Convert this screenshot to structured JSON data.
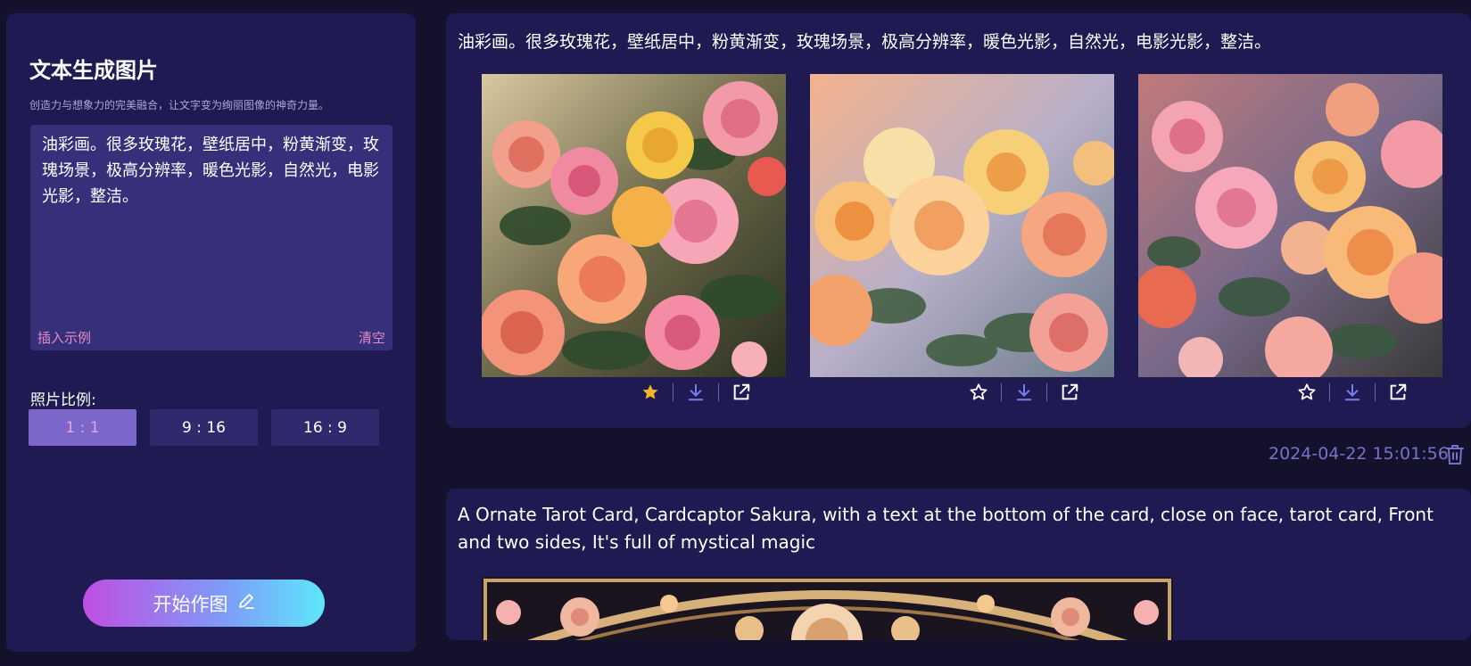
{
  "panel": {
    "title": "文本生成图片",
    "subtitle": "创造力与想象力的完美融合，让文字变为绚丽图像的神奇力量。",
    "prompt_value": "油彩画。很多玫瑰花，壁纸居中，粉黄渐变，玫瑰场景，极高分辨率，暖色光影，自然光，电影光影，整洁。",
    "insert_example_label": "插入示例",
    "clear_label": "清空",
    "ratio_label": "照片比例:",
    "ratios": [
      "1 : 1",
      "9 : 16",
      "16 : 9"
    ],
    "selected_ratio": "1 : 1",
    "start_label": "开始作图"
  },
  "results": [
    {
      "prompt": "油彩画。很多玫瑰花，壁纸居中，粉黄渐变，玫瑰场景，极高分辨率，暖色光影，自然光，电影光影，整洁。",
      "images": [
        {
          "favorited": true
        },
        {
          "favorited": false
        },
        {
          "favorited": false
        }
      ],
      "timestamp": "2024-04-22 15:01:56"
    },
    {
      "prompt": "A Ornate Tarot Card, Cardcaptor Sakura, with a text at the bottom of the card, close on face, tarot card, Front and two sides, It's full of mystical magic"
    }
  ],
  "colors": {
    "background": "#13112b",
    "panel": "#1f1a52",
    "accent": "#7b66c9",
    "favorite": "#f5b623",
    "download": "#7a7bf5",
    "link": "#e48ac4"
  }
}
